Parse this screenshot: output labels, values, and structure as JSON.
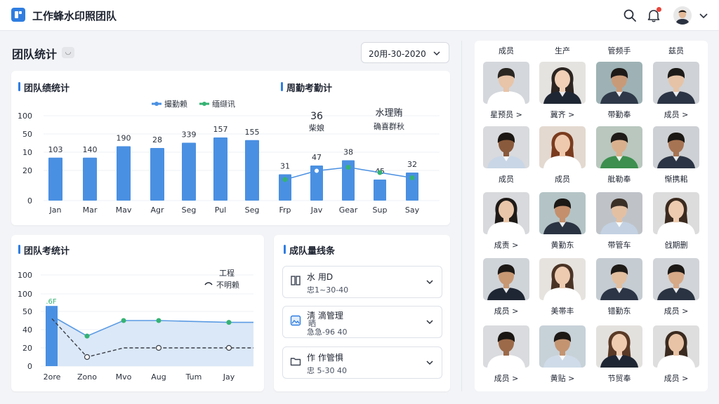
{
  "app": {
    "title": "工作蜂水印照团队"
  },
  "page": {
    "title": "团队统计",
    "date_range": "20用-30-2020"
  },
  "colors": {
    "accent": "#2f7de1",
    "secondary": "#35b373",
    "bar": "#4a90e2"
  },
  "chart_data": [
    {
      "type": "bar",
      "title": "团队绩统计",
      "legend": [
        {
          "name": "撮勤赖",
          "color": "#4a90e2"
        },
        {
          "name": "缅缬讯",
          "color": "#35b373"
        }
      ],
      "y_ticks": [
        "100",
        "50",
        "10",
        "20",
        "0"
      ],
      "categories": [
        "Jan",
        "Mar",
        "Mav",
        "Agr",
        "Seg",
        "Pul",
        "Seg"
      ],
      "values": [
        103,
        140,
        190,
        28,
        339,
        157,
        155
      ],
      "value_labels": [
        "103",
        "140",
        "190",
        "28",
        "339",
        "157",
        "155"
      ],
      "bar_height_pct": [
        0.49,
        0.49,
        0.62,
        0.6,
        0.66,
        0.72,
        0.69
      ]
    },
    {
      "type": "bar+line",
      "title": "周勤考勤计",
      "stat1": {
        "value": "36",
        "label": "柴娘"
      },
      "stat2": {
        "value": "水理贿",
        "label": "确喜群秋"
      },
      "categories": [
        "Frp",
        "Jav",
        "Gear",
        "Sup",
        "Say"
      ],
      "values": [
        31,
        47,
        38,
        45,
        32
      ],
      "value_labels": [
        "31",
        "47",
        "38",
        "45",
        "32"
      ],
      "bar_height_pct": [
        0.3,
        0.4,
        0.46,
        0.24,
        0.32
      ],
      "line_pct": [
        0.24,
        0.34,
        0.38,
        0.32,
        0.26
      ]
    },
    {
      "type": "area+line",
      "title": "团队考统计",
      "legend": [
        {
          "name": "工程",
          "color": "#1d2330"
        },
        {
          "name": "不明赖",
          "color": "#1d2330"
        }
      ],
      "y_ticks": [
        "100",
        "100",
        "50",
        "40",
        "20",
        "0"
      ],
      "categories": [
        "2ore",
        "Zono",
        "Mvo",
        "Aug",
        "Tum",
        "Jay"
      ],
      "top_label": ".6F",
      "bar_pct": 0.66,
      "area_pct": [
        0.55,
        0.33,
        0.5,
        0.5,
        0.49,
        0.48
      ],
      "dash_pct": [
        0.52,
        0.1,
        0.2,
        0.2,
        0.2,
        0.2
      ]
    }
  ],
  "members_card": {
    "title": "成队量线条",
    "items": [
      {
        "name": "水 用D",
        "sub": "忠1~30-40",
        "icon": "book-icon"
      },
      {
        "name": "淸 滴管理",
        "name2": "晒",
        "sub": "急急-96 40",
        "icon": "image-icon"
      },
      {
        "name": "作 作管惧",
        "sub": "忠 5-30 40",
        "icon": "folder-icon"
      }
    ]
  },
  "grid": {
    "headers": [
      "成员",
      "生产",
      "管频手",
      "兹员"
    ],
    "labels": [
      [
        "星预员 >",
        "冀齐 >",
        "带勤奉",
        "成员 >"
      ],
      [
        "成员",
        "成员",
        "舭勒奉",
        "惭携耜"
      ],
      [
        "成责 >",
        "黄勤东",
        "带管车",
        "戗期删"
      ],
      [
        "成员 >",
        "美帯丰",
        "错勤东",
        "成员 >"
      ],
      [
        "成员 >",
        "黄贴 >",
        "节贸奉",
        "成员 >"
      ]
    ],
    "people": [
      [
        {
          "skin": "#e8c4a8",
          "hair": "#2a2622",
          "shirt": "#ffffff",
          "bg": "#d4d7dc",
          "long": false
        },
        {
          "skin": "#f0cfb6",
          "hair": "#2b2421",
          "shirt": "#1f2633",
          "bg": "#e5e3e0",
          "long": true
        },
        {
          "skin": "#c99a78",
          "hair": "#1e1a17",
          "shirt": "#2e3848",
          "bg": "#9eb2b5",
          "long": false
        },
        {
          "skin": "#e6c3a6",
          "hair": "#1d1b19",
          "shirt": "#2b3444",
          "bg": "#cfd2d6",
          "long": false
        }
      ],
      [
        {
          "skin": "#8a5a3c",
          "hair": "#1b1613",
          "shirt": "#c9d6e6",
          "bg": "#d8dadd",
          "long": false
        },
        {
          "skin": "#efc9ad",
          "hair": "#7a3b1e",
          "shirt": "#ffffff",
          "bg": "#e3d9d0",
          "long": true
        },
        {
          "skin": "#d9b08e",
          "hair": "#1f1b18",
          "shirt": "#3c8f4e",
          "bg": "#b9c7be",
          "long": false
        },
        {
          "skin": "#a77453",
          "hair": "#1b1815",
          "shirt": "#2b3444",
          "bg": "#cdd0d4",
          "long": false
        }
      ],
      [
        {
          "skin": "#e9c6a9",
          "hair": "#1e1a18",
          "shirt": "#ffffff",
          "bg": "#d8d9dc",
          "long": true
        },
        {
          "skin": "#c48f6c",
          "hair": "#1c1815",
          "shirt": "#2a3342",
          "bg": "#b4c4c6",
          "long": false
        },
        {
          "skin": "#e4c0a3",
          "hair": "#3a2f27",
          "shirt": "#c3d1e2",
          "bg": "#bfc3c8",
          "long": false
        },
        {
          "skin": "#edcbb0",
          "hair": "#3b2a1f",
          "shirt": "#ffffff",
          "bg": "#dcdcdc",
          "long": true
        }
      ],
      [
        {
          "skin": "#c89873",
          "hair": "#1d1916",
          "shirt": "#1f2633",
          "bg": "#cfd4d9",
          "long": false
        },
        {
          "skin": "#eccbb1",
          "hair": "#4a3325",
          "shirt": "#ffffff",
          "bg": "#e6e3df",
          "long": true
        },
        {
          "skin": "#e2bf9f",
          "hair": "#1f1b17",
          "shirt": "#2c3545",
          "bg": "#c5ccd2",
          "long": false
        },
        {
          "skin": "#d6a987",
          "hair": "#1c1916",
          "shirt": "#2a3342",
          "bg": "#d1d4d8",
          "long": false
        }
      ],
      [
        {
          "skin": "#9c6a49",
          "hair": "#1a1613",
          "shirt": "#ffffff",
          "bg": "#d9dbde",
          "long": false
        },
        {
          "skin": "#c49471",
          "hair": "#1d1916",
          "shirt": "#cfdbe8",
          "bg": "#c7d1d8",
          "long": false
        },
        {
          "skin": "#efcbb0",
          "hair": "#5a3a26",
          "shirt": "#1f2633",
          "bg": "#e3e1de",
          "long": true
        },
        {
          "skin": "#e8c3a5",
          "hair": "#3a2a1f",
          "shirt": "#ffffff",
          "bg": "#dedede",
          "long": true
        }
      ]
    ]
  }
}
